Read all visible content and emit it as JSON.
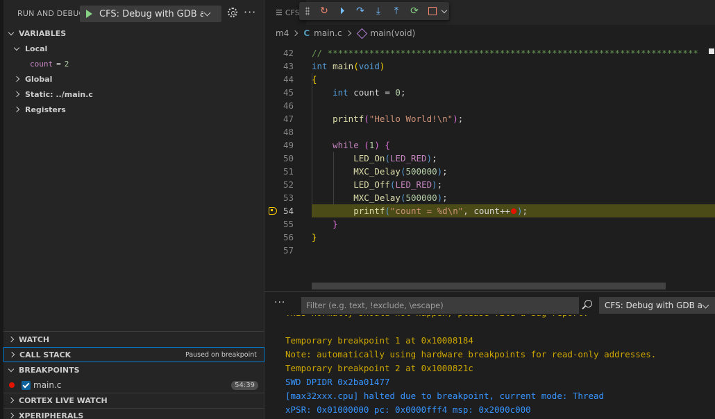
{
  "sidebar": {
    "title": "RUN AND DEBUG",
    "launch_config": "CFS: Debug with GDB and",
    "variables_header": "VARIABLES",
    "local_label": "Local",
    "local_vars": [
      {
        "name": "count",
        "eq": "=",
        "value": "2"
      }
    ],
    "scopes": [
      "Global",
      "Static: ../main.c",
      "Registers"
    ],
    "watch_header": "WATCH",
    "call_stack_header": "CALL STACK",
    "call_stack_status": "Paused on breakpoint",
    "breakpoints_header": "BREAKPOINTS",
    "breakpoint": {
      "file": "main.c",
      "location": "54:39",
      "checked": true
    },
    "cortex_live_watch_header": "CORTEX LIVE WATCH",
    "xperipherals_header": "XPERIPHERALS"
  },
  "editor": {
    "tab_label": "CFS",
    "breadcrumb": [
      "m4",
      "main.c",
      "main(void)"
    ],
    "current_line": 54,
    "code_lines": [
      {
        "num": "42",
        "tokens": [
          {
            "t": "// ***********************************************************************",
            "c": "c"
          }
        ]
      },
      {
        "num": "43",
        "tokens": [
          {
            "t": "int",
            "c": "k"
          },
          {
            "t": " ",
            "c": "p"
          },
          {
            "t": "main",
            "c": "f"
          },
          {
            "t": "(",
            "c": "br"
          },
          {
            "t": "void",
            "c": "k"
          },
          {
            "t": ")",
            "c": "br"
          }
        ]
      },
      {
        "num": "44",
        "tokens": [
          {
            "t": "{",
            "c": "br"
          }
        ]
      },
      {
        "num": "45",
        "tokens": [
          {
            "t": "    ",
            "c": "p"
          },
          {
            "t": "int",
            "c": "k"
          },
          {
            "t": " count = ",
            "c": "p"
          },
          {
            "t": "0",
            "c": "n"
          },
          {
            "t": ";",
            "c": "p"
          }
        ]
      },
      {
        "num": "46",
        "tokens": []
      },
      {
        "num": "47",
        "tokens": [
          {
            "t": "    ",
            "c": "p"
          },
          {
            "t": "printf",
            "c": "f"
          },
          {
            "t": "(",
            "c": "br2"
          },
          {
            "t": "\"Hello World!\\n\"",
            "c": "s"
          },
          {
            "t": ")",
            "c": "br2"
          },
          {
            "t": ";",
            "c": "p"
          }
        ]
      },
      {
        "num": "48",
        "tokens": []
      },
      {
        "num": "49",
        "tokens": [
          {
            "t": "    ",
            "c": "p"
          },
          {
            "t": "while",
            "c": "m"
          },
          {
            "t": " ",
            "c": "p"
          },
          {
            "t": "(",
            "c": "br2"
          },
          {
            "t": "1",
            "c": "n"
          },
          {
            "t": ")",
            "c": "br2"
          },
          {
            "t": " ",
            "c": "p"
          },
          {
            "t": "{",
            "c": "br2"
          }
        ]
      },
      {
        "num": "50",
        "tokens": [
          {
            "t": "        ",
            "c": "p"
          },
          {
            "t": "LED_On",
            "c": "f"
          },
          {
            "t": "(",
            "c": "k"
          },
          {
            "t": "LED_RED",
            "c": "m"
          },
          {
            "t": ")",
            "c": "k"
          },
          {
            "t": ";",
            "c": "p"
          }
        ]
      },
      {
        "num": "51",
        "tokens": [
          {
            "t": "        ",
            "c": "p"
          },
          {
            "t": "MXC_Delay",
            "c": "f"
          },
          {
            "t": "(",
            "c": "k"
          },
          {
            "t": "500000",
            "c": "n"
          },
          {
            "t": ")",
            "c": "k"
          },
          {
            "t": ";",
            "c": "p"
          }
        ]
      },
      {
        "num": "52",
        "tokens": [
          {
            "t": "        ",
            "c": "p"
          },
          {
            "t": "LED_Off",
            "c": "f"
          },
          {
            "t": "(",
            "c": "k"
          },
          {
            "t": "LED_RED",
            "c": "m"
          },
          {
            "t": ")",
            "c": "k"
          },
          {
            "t": ";",
            "c": "p"
          }
        ]
      },
      {
        "num": "53",
        "tokens": [
          {
            "t": "        ",
            "c": "p"
          },
          {
            "t": "MXC_Delay",
            "c": "f"
          },
          {
            "t": "(",
            "c": "k"
          },
          {
            "t": "500000",
            "c": "n"
          },
          {
            "t": ")",
            "c": "k"
          },
          {
            "t": ";",
            "c": "p"
          }
        ]
      },
      {
        "num": "54",
        "tokens": [
          {
            "t": "        ",
            "c": "p"
          },
          {
            "t": "printf",
            "c": "f"
          },
          {
            "t": "(",
            "c": "k"
          },
          {
            "t": "\"count = %d\\n\"",
            "c": "s"
          },
          {
            "t": ", count++",
            "c": "p"
          },
          {
            "t": "BP",
            "c": "bp"
          },
          {
            "t": ")",
            "c": "k"
          },
          {
            "t": ";",
            "c": "p"
          }
        ]
      },
      {
        "num": "55",
        "tokens": [
          {
            "t": "    ",
            "c": "p"
          },
          {
            "t": "}",
            "c": "br2"
          }
        ]
      },
      {
        "num": "56",
        "tokens": [
          {
            "t": "}",
            "c": "br"
          }
        ]
      },
      {
        "num": "57",
        "tokens": []
      }
    ]
  },
  "debug_console": {
    "filter_placeholder": "Filter (e.g. text, !exclude, \\escape)",
    "session": "CFS: Debug with GDB a",
    "lines": [
      {
        "text": "This normally should not happen, please file a bug report.",
        "color": "yellow"
      },
      {
        "text": "",
        "color": "yellow"
      },
      {
        "text": "Temporary breakpoint 1 at 0x10008184",
        "color": "yellow"
      },
      {
        "text": "Note: automatically using hardware breakpoints for read-only addresses.",
        "color": "yellow"
      },
      {
        "text": "Temporary breakpoint 2 at 0x1000821c",
        "color": "yellow"
      },
      {
        "text": "SWD DPIDR 0x2ba01477",
        "color": "blue"
      },
      {
        "text": "[max32xxx.cpu] halted due to breakpoint, current mode: Thread",
        "color": "blue"
      },
      {
        "text": "xPSR: 0x01000000 pc: 0x0000fff4 msp: 0x2000c000",
        "color": "blue"
      }
    ]
  },
  "colors": {
    "accent": "#007fd4",
    "breakpoint": "#e51400",
    "current_line_bg": "#4b4b18",
    "console_warning": "#cca700",
    "console_info": "#3794ff"
  }
}
